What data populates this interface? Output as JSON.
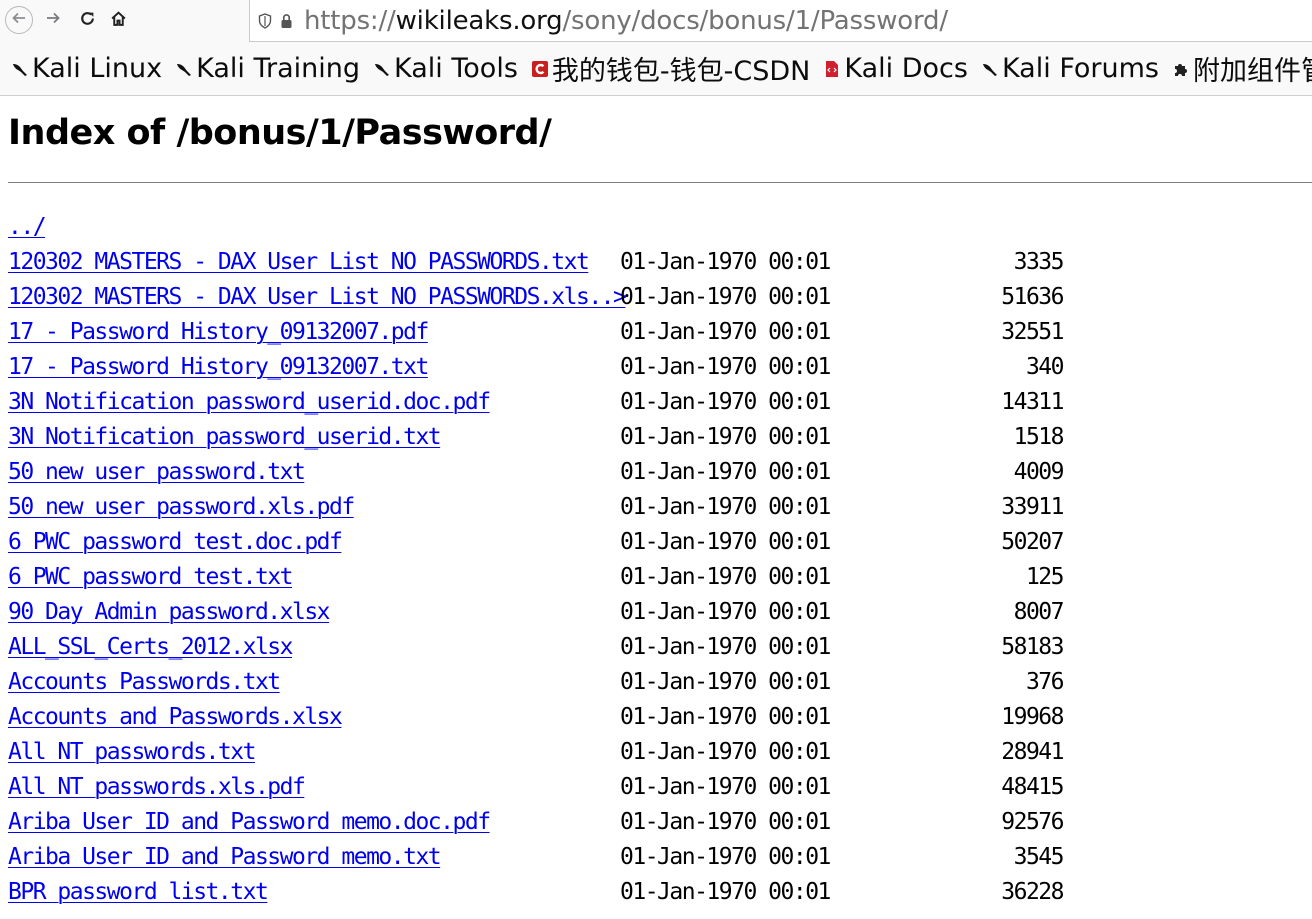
{
  "browser": {
    "url_prefix": "https://",
    "url_host": "wikileaks.org",
    "url_path": "/sony/docs/bonus/1/Password/"
  },
  "bookmarks": [
    {
      "label": "Kali Linux",
      "icon": "kali-dragon-icon"
    },
    {
      "label": "Kali Training",
      "icon": "kali-dragon-icon"
    },
    {
      "label": "Kali Tools",
      "icon": "kali-dragon-icon"
    },
    {
      "label": "我的钱包-钱包-CSDN",
      "icon": "csdn-icon"
    },
    {
      "label": "Kali Docs",
      "icon": "kali-docs-icon"
    },
    {
      "label": "Kali Forums",
      "icon": "kali-dragon-icon"
    },
    {
      "label": "附加组件管",
      "icon": "puzzle-icon"
    }
  ],
  "page": {
    "title": "Index of /bonus/1/Password/"
  },
  "listing": [
    {
      "name": "../",
      "date": "",
      "size": ""
    },
    {
      "name": "120302 MASTERS - DAX User List NO PASSWORDS.txt",
      "date": "01-Jan-1970 00:01",
      "size": "3335"
    },
    {
      "name": "120302 MASTERS - DAX User List NO PASSWORDS.xls..>",
      "date": "01-Jan-1970 00:01",
      "size": "51636"
    },
    {
      "name": "17 - Password History_09132007.pdf",
      "date": "01-Jan-1970 00:01",
      "size": "32551"
    },
    {
      "name": "17 - Password History_09132007.txt",
      "date": "01-Jan-1970 00:01",
      "size": "340"
    },
    {
      "name": "3N Notification password_userid.doc.pdf",
      "date": "01-Jan-1970 00:01",
      "size": "14311"
    },
    {
      "name": "3N Notification password_userid.txt",
      "date": "01-Jan-1970 00:01",
      "size": "1518"
    },
    {
      "name": "50 new user password.txt",
      "date": "01-Jan-1970 00:01",
      "size": "4009"
    },
    {
      "name": "50 new user password.xls.pdf",
      "date": "01-Jan-1970 00:01",
      "size": "33911"
    },
    {
      "name": "6 PWC password test.doc.pdf",
      "date": "01-Jan-1970 00:01",
      "size": "50207"
    },
    {
      "name": "6 PWC password test.txt",
      "date": "01-Jan-1970 00:01",
      "size": "125"
    },
    {
      "name": "90 Day Admin password.xlsx",
      "date": "01-Jan-1970 00:01",
      "size": "8007"
    },
    {
      "name": "ALL_SSL_Certs_2012.xlsx",
      "date": "01-Jan-1970 00:01",
      "size": "58183"
    },
    {
      "name": "Accounts Passwords.txt",
      "date": "01-Jan-1970 00:01",
      "size": "376"
    },
    {
      "name": "Accounts and Passwords.xlsx",
      "date": "01-Jan-1970 00:01",
      "size": "19968"
    },
    {
      "name": "All NT passwords.txt",
      "date": "01-Jan-1970 00:01",
      "size": "28941"
    },
    {
      "name": "All NT passwords.xls.pdf",
      "date": "01-Jan-1970 00:01",
      "size": "48415"
    },
    {
      "name": "Ariba User ID and Password memo.doc.pdf",
      "date": "01-Jan-1970 00:01",
      "size": "92576"
    },
    {
      "name": "Ariba User ID and Password memo.txt",
      "date": "01-Jan-1970 00:01",
      "size": "3545"
    },
    {
      "name": "BPR password list.txt",
      "date": "01-Jan-1970 00:01",
      "size": "36228"
    }
  ]
}
